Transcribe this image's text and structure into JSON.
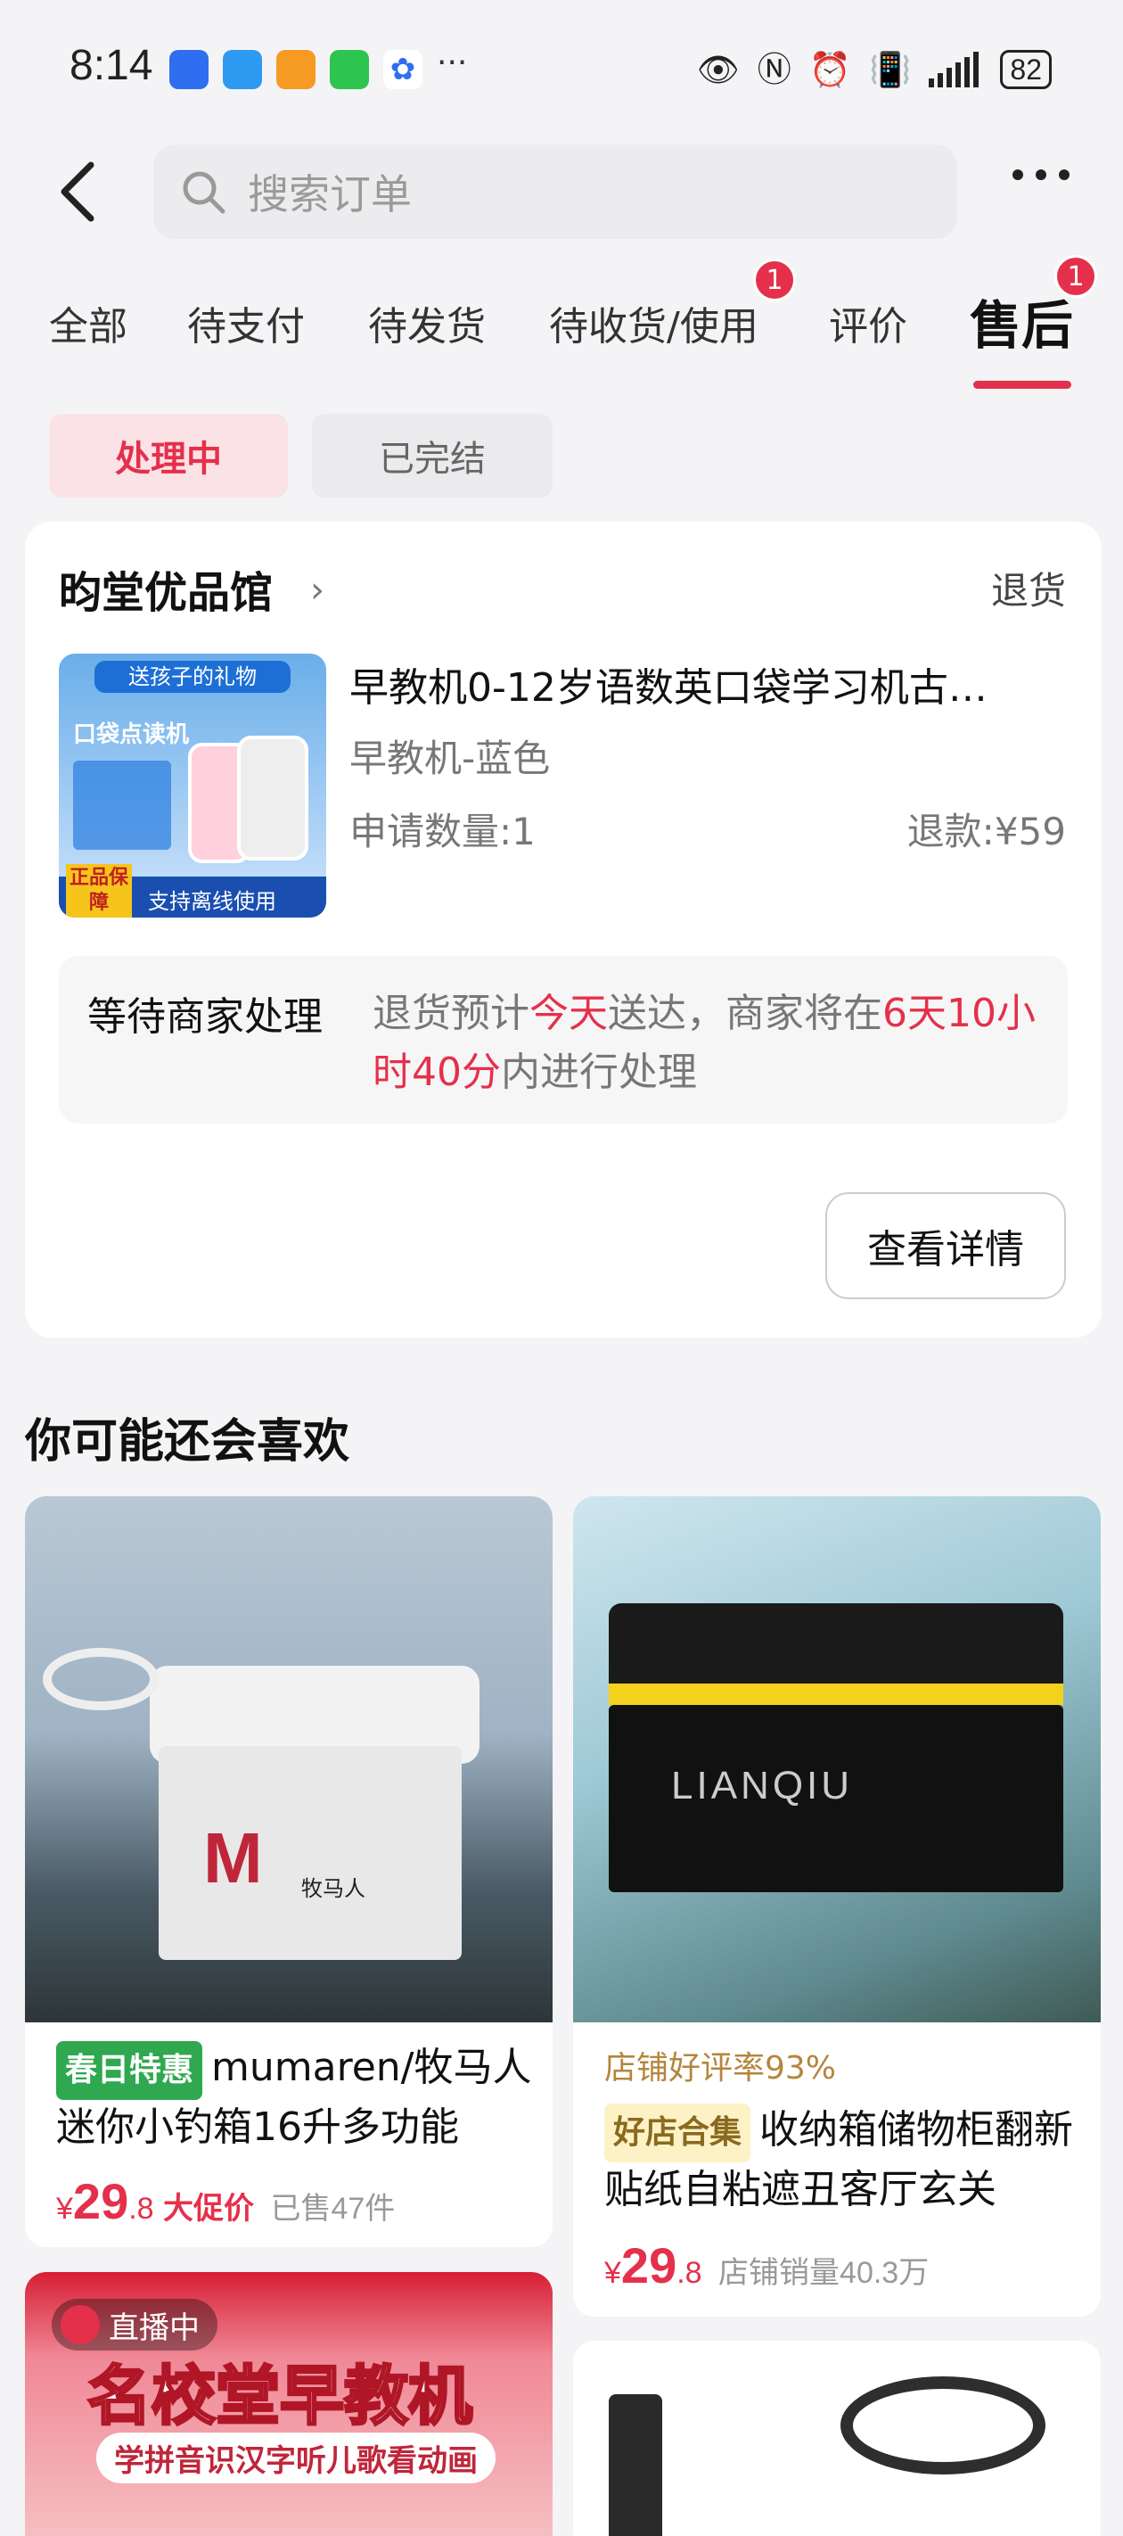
{
  "status_bar": {
    "time": "8:14",
    "battery": "82",
    "more": "···"
  },
  "header": {
    "search_placeholder": "搜索订单"
  },
  "tabs": [
    {
      "label": "全部"
    },
    {
      "label": "待支付"
    },
    {
      "label": "待发货"
    },
    {
      "label": "待收货/使用",
      "badge": "1"
    },
    {
      "label": "评价"
    },
    {
      "label": "售后",
      "badge": "1",
      "active": true
    }
  ],
  "filters": {
    "processing": "处理中",
    "finished": "已完结"
  },
  "order": {
    "shop_name": "昀堂优品馆",
    "status": "退货",
    "image_texts": {
      "banner": "送孩子的礼物",
      "title": "口袋点读机",
      "badge": "正品保障",
      "footer": "支持离线使用"
    },
    "title": "早教机0-12岁语数英口袋学习机古…",
    "spec": "早教机-蓝色",
    "quantity": "申请数量:1",
    "refund": "退款:¥59",
    "notice_label": "等待商家处理",
    "notice": {
      "part1": "退货预计",
      "today": "今天",
      "part2": "送达，商家将在",
      "time": "6天10小时40分",
      "part3": "内进行处理"
    },
    "details_button": "查看详情"
  },
  "recommend": {
    "title": "你可能还会喜欢",
    "items": [
      {
        "tag": "春日特惠",
        "name": "mumaren/牧马人迷你小钓箱16升多功能",
        "price_symbol": "¥",
        "price_int": "29",
        "price_dec": ".8",
        "promo": "大促价",
        "sold": "已售47件",
        "logo": "牧马人"
      },
      {
        "note": "店铺好评率93%",
        "tag": "好店合集",
        "name": "收纳箱储物柜翻新贴纸自粘遮丑客厅玄关",
        "price_symbol": "¥",
        "price_int": "29",
        "price_dec": ".8",
        "sold": "店铺销量40.3万",
        "logo": "LIANQIU"
      },
      {
        "live": "直播中",
        "banner_title": "名校堂早教机",
        "banner_sub": "学拼音识汉字听儿歌看动画"
      }
    ]
  }
}
